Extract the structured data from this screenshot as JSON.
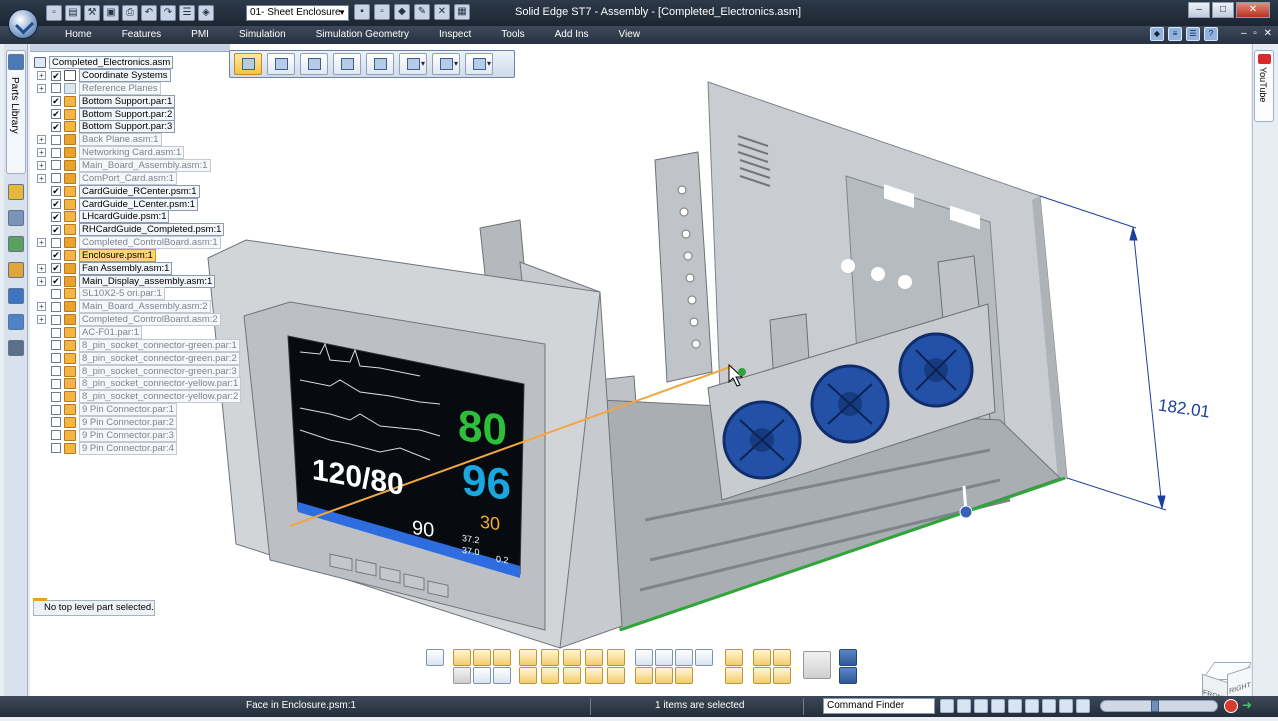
{
  "window": {
    "title": "Solid Edge ST7 - Assembly - [Completed_Electronics.asm]",
    "environment": "01- Sheet Enclosure",
    "controls": [
      "–",
      "□",
      "✕"
    ]
  },
  "ribbon": {
    "tabs": [
      "Home",
      "Features",
      "PMI",
      "Simulation",
      "Simulation Geometry",
      "Inspect",
      "Tools",
      "Add Ins",
      "View"
    ],
    "window_controls": "– ▫ ✕"
  },
  "left_rail": {
    "parts_library_label": "Parts Library"
  },
  "right_rail": {
    "youtube_label": "YouTube"
  },
  "tree": {
    "root": "Completed_Electronics.asm",
    "items": [
      {
        "label": "Coordinate Systems",
        "expand": "+",
        "checked": true,
        "style": "bold",
        "icon": "coord"
      },
      {
        "label": "Reference Planes",
        "expand": "+",
        "checked": false,
        "style": "dim",
        "icon": "ref"
      },
      {
        "label": "Bottom Support.par:1",
        "expand": "",
        "checked": true,
        "style": "bold",
        "icon": "part"
      },
      {
        "label": "Bottom Support.par:2",
        "expand": "",
        "checked": true,
        "style": "bold",
        "icon": "part"
      },
      {
        "label": "Bottom Support.par:3",
        "expand": "",
        "checked": true,
        "style": "bold",
        "icon": "part"
      },
      {
        "label": "Back Plane.asm:1",
        "expand": "+",
        "checked": false,
        "style": "dim",
        "icon": "asm"
      },
      {
        "label": "Networking Card.asm:1",
        "expand": "+",
        "checked": false,
        "style": "dim",
        "icon": "asm"
      },
      {
        "label": "Main_Board_Assembly.asm:1",
        "expand": "+",
        "checked": false,
        "style": "dim",
        "icon": "asm"
      },
      {
        "label": "ComPort_Card.asm:1",
        "expand": "+",
        "checked": false,
        "style": "dim",
        "icon": "asm"
      },
      {
        "label": "CardGuide_RCenter.psm:1",
        "expand": "",
        "checked": true,
        "style": "bold",
        "icon": "part"
      },
      {
        "label": "CardGuide_LCenter.psm:1",
        "expand": "",
        "checked": true,
        "style": "bold",
        "icon": "part"
      },
      {
        "label": "LHcardGuide.psm:1",
        "expand": "",
        "checked": true,
        "style": "bold",
        "icon": "part"
      },
      {
        "label": "RHCardGuide_Completed.psm:1",
        "expand": "",
        "checked": true,
        "style": "bold",
        "icon": "part"
      },
      {
        "label": "Completed_ControlBoard.asm:1",
        "expand": "+",
        "checked": false,
        "style": "dim",
        "icon": "asm"
      },
      {
        "label": "Enclosure.psm:1",
        "expand": "",
        "checked": true,
        "style": "sel",
        "icon": "part"
      },
      {
        "label": "Fan Assembly.asm:1",
        "expand": "+",
        "checked": true,
        "style": "bold",
        "icon": "asm"
      },
      {
        "label": "Main_Display_assembly.asm:1",
        "expand": "+",
        "checked": true,
        "style": "bold",
        "icon": "asm"
      },
      {
        "label": "SL10X2-5 ori.par:1",
        "expand": "",
        "checked": false,
        "style": "dim",
        "icon": "part"
      },
      {
        "label": "Main_Board_Assembly.asm:2",
        "expand": "+",
        "checked": false,
        "style": "dim",
        "icon": "asm"
      },
      {
        "label": "Completed_ControlBoard.asm:2",
        "expand": "+",
        "checked": false,
        "style": "dim",
        "icon": "asm"
      },
      {
        "label": "AC-F01.par:1",
        "expand": "",
        "checked": false,
        "style": "dim",
        "icon": "part"
      },
      {
        "label": "8_pin_socket_connector-green.par:1",
        "expand": "",
        "checked": false,
        "style": "dim",
        "icon": "part"
      },
      {
        "label": "8_pin_socket_connector-green.par:2",
        "expand": "",
        "checked": false,
        "style": "dim",
        "icon": "part"
      },
      {
        "label": "8_pin_socket_connector-green.par:3",
        "expand": "",
        "checked": false,
        "style": "dim",
        "icon": "part"
      },
      {
        "label": "8_pin_socket_connector-yellow.par:1",
        "expand": "",
        "checked": false,
        "style": "dim",
        "icon": "part"
      },
      {
        "label": "8_pin_socket_connector-yellow.par:2",
        "expand": "",
        "checked": false,
        "style": "dim",
        "icon": "part"
      },
      {
        "label": "9 Pin Connector.par:1",
        "expand": "",
        "checked": false,
        "style": "dim",
        "icon": "part"
      },
      {
        "label": "9 Pin Connector.par:2",
        "expand": "",
        "checked": false,
        "style": "dim",
        "icon": "part"
      },
      {
        "label": "9 Pin Connector.par:3",
        "expand": "",
        "checked": false,
        "style": "dim",
        "icon": "part"
      },
      {
        "label": "9 Pin Connector.par:4",
        "expand": "",
        "checked": false,
        "style": "dim",
        "icon": "part"
      }
    ],
    "status": "No top level part selected."
  },
  "model": {
    "dimension": "182.01",
    "monitor": {
      "hr": "80",
      "spo2": "96",
      "bp": "120/80",
      "map": "90",
      "resp": "30",
      "temp1": "37.2",
      "temp2": "37.0",
      "delta": "0.2"
    },
    "cube": {
      "front": "FRONT",
      "right": "RIGHT"
    }
  },
  "statusbar": {
    "message": "Face in Enclosure.psm:1",
    "selection": "1 items are selected",
    "command_finder": "Command Finder"
  },
  "colors": {
    "accent": "#f6c24a",
    "dimension": "#1b3f9c",
    "fan": "#2451a8",
    "hr": "#2dbf3a",
    "spo2": "#1aa7e0",
    "resp": "#f2b229"
  }
}
